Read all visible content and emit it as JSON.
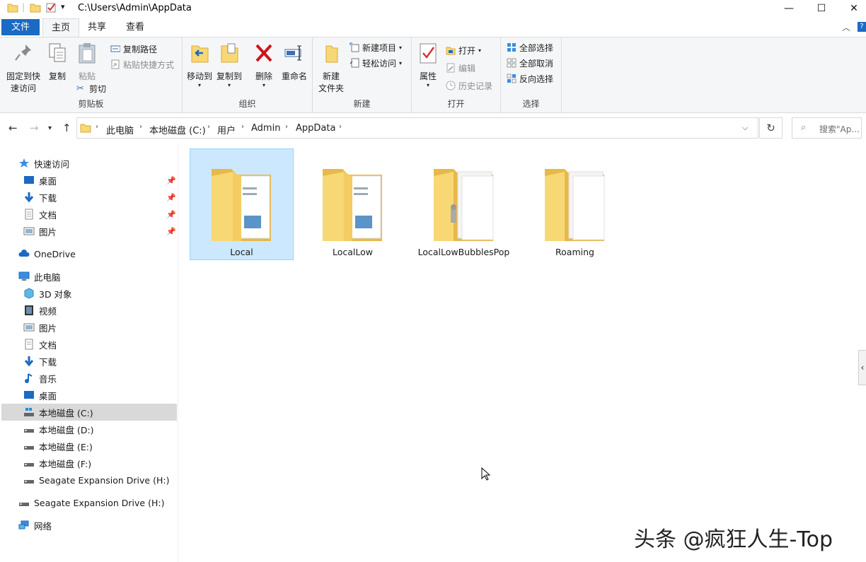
{
  "window": {
    "title": "C:\\Users\\Admin\\AppData",
    "minimize": "—",
    "maximize": "☐",
    "close": "✕"
  },
  "tabs": {
    "file": "文件",
    "home": "主页",
    "share": "共享",
    "view": "查看"
  },
  "ribbon": {
    "clipboard": {
      "label": "剪贴板",
      "pin": "固定到快\n速访问",
      "pin_line1": "固定到快",
      "pin_line2": "速访问",
      "copy": "复制",
      "paste": "粘贴",
      "copy_path": "复制路径",
      "paste_shortcut": "粘贴快捷方式",
      "cut": "剪切"
    },
    "organize": {
      "label": "组织",
      "move_to": "移动到",
      "copy_to": "复制到",
      "delete": "删除",
      "rename": "重命名"
    },
    "new": {
      "label": "新建",
      "new_folder_line1": "新建",
      "new_folder_line2": "文件夹",
      "new_item": "新建项目",
      "easy_access": "轻松访问"
    },
    "open": {
      "label": "打开",
      "properties": "属性",
      "open": "打开",
      "edit": "编辑",
      "history": "历史记录"
    },
    "select": {
      "label": "选择",
      "select_all": "全部选择",
      "select_none": "全部取消",
      "invert": "反向选择"
    }
  },
  "address": {
    "crumbs": [
      "此电脑",
      "本地磁盘 (C:)",
      "用户",
      "Admin",
      "AppData"
    ],
    "search_placeholder": "搜索\"Ap..."
  },
  "sidebar": {
    "quick_access": "快速访问",
    "quick_items": [
      "桌面",
      "下载",
      "文档",
      "图片"
    ],
    "onedrive": "OneDrive",
    "this_pc": "此电脑",
    "pc_items": [
      "3D 对象",
      "视频",
      "图片",
      "文档",
      "下载",
      "音乐",
      "桌面",
      "本地磁盘 (C:)",
      "本地磁盘 (D:)",
      "本地磁盘 (E:)",
      "本地磁盘 (F:)",
      "Seagate Expansion Drive (H:)"
    ],
    "external_drive": "Seagate Expansion Drive (H:)",
    "network": "网络"
  },
  "folders": [
    {
      "name": "Local",
      "selected": true
    },
    {
      "name": "LocalLow",
      "selected": false
    },
    {
      "name": "LocalLowBubblesPop",
      "selected": false
    },
    {
      "name": "Roaming",
      "selected": false
    }
  ],
  "watermark": "头条 @疯狂人生-Top",
  "colors": {
    "accent": "#1b6ac3",
    "selection": "#cce8ff",
    "folder": "#f8d775"
  }
}
